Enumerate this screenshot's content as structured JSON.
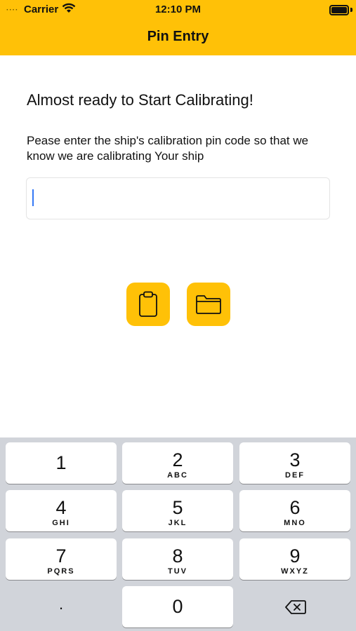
{
  "status_bar": {
    "carrier": "Carrier",
    "time": "12:10 PM"
  },
  "nav": {
    "title": "Pin Entry"
  },
  "content": {
    "heading": "Almost ready to Start Calibrating!",
    "description": "Pease enter the ship's calibration pin code so that we know we are calibrating Your ship",
    "pin_value": ""
  },
  "actions": [
    {
      "icon": "clipboard-icon"
    },
    {
      "icon": "folder-icon"
    }
  ],
  "keypad": {
    "keys": [
      {
        "num": "1",
        "letters": ""
      },
      {
        "num": "2",
        "letters": "ABC"
      },
      {
        "num": "3",
        "letters": "DEF"
      },
      {
        "num": "4",
        "letters": "GHI"
      },
      {
        "num": "5",
        "letters": "JKL"
      },
      {
        "num": "6",
        "letters": "MNO"
      },
      {
        "num": "7",
        "letters": "PQRS"
      },
      {
        "num": "8",
        "letters": "TUV"
      },
      {
        "num": "9",
        "letters": "WXYZ"
      },
      {
        "num": "0",
        "letters": ""
      }
    ],
    "dot": "."
  },
  "colors": {
    "accent": "#FFC107",
    "caret": "#3478F6",
    "keyboard_bg": "#D1D4DA"
  }
}
